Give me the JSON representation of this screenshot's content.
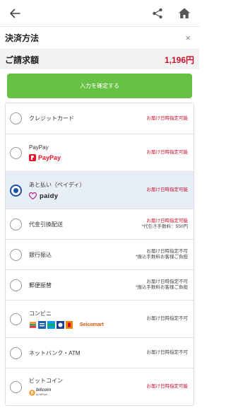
{
  "header": {
    "title": "決済方法",
    "close": "×"
  },
  "billing": {
    "label": "ご請求額",
    "amount": "1,196円"
  },
  "confirm_label": "入力を確定する",
  "methods": [
    {
      "name": "クレジットカード",
      "status": "お届け日時指定可能",
      "status_color": "#c8102e"
    },
    {
      "name": "PayPay",
      "logo_text": "PayPay",
      "status": "お届け日時指定可能",
      "status_color": "#c8102e"
    },
    {
      "name": "あと払い（ペイディ）",
      "logo_text": "paidy",
      "status": "お届け日時指定可能",
      "status_color": "#c8102e",
      "selected": true
    },
    {
      "name": "代金引換配送",
      "status": "お届け日時指定可能",
      "note": "*代引き手数料：550円"
    },
    {
      "name": "銀行振込",
      "status": "お届け日時指定不可",
      "note": "*振込手数料お客様ご負担"
    },
    {
      "name": "郵便振替",
      "status": "お届け日時指定不可",
      "note": "*振込手数料お客様ご負担"
    },
    {
      "name": "コンビニ",
      "logo_text": "Seicomart",
      "status": "お届け日時指定不可"
    },
    {
      "name": "ネットバンク・ATM",
      "status": "お届け日時指定不可"
    },
    {
      "name": "ビットコイン",
      "logo_text": "bitcoin",
      "logo_sub": "by bitFlyer",
      "status": "お届け日時指定可能"
    }
  ],
  "colors": {
    "accent_green": "#66c145",
    "price_red": "#c8102e",
    "selected_blue": "#1e4fa8"
  },
  "icons": {
    "back": "arrow-left-icon",
    "share": "share-icon",
    "home": "home-icon"
  }
}
